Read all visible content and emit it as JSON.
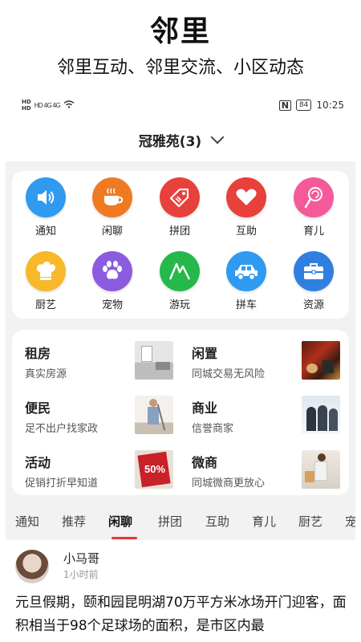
{
  "promo": {
    "title": "邻里",
    "subtitle": "邻里互动、邻里交流、小区动态"
  },
  "status_bar": {
    "left": "HD 4G 4G",
    "battery": "84",
    "time": "10:25"
  },
  "community": {
    "name": "冠雅苑(3)"
  },
  "categories": [
    {
      "label": "通知",
      "icon": "speaker-icon",
      "color": "#2f9af0"
    },
    {
      "label": "闲聊",
      "icon": "coffee-cup-icon",
      "color": "#f07a22"
    },
    {
      "label": "拼团",
      "icon": "tag-icon",
      "color": "#e8403a"
    },
    {
      "label": "互助",
      "icon": "heart-icon",
      "color": "#e8403a"
    },
    {
      "label": "育儿",
      "icon": "lollipop-icon",
      "color": "#f45a9a"
    },
    {
      "label": "厨艺",
      "icon": "chef-hat-icon",
      "color": "#f7b82a"
    },
    {
      "label": "宠物",
      "icon": "paw-icon",
      "color": "#8b5be0"
    },
    {
      "label": "游玩",
      "icon": "mountain-icon",
      "color": "#25b84a"
    },
    {
      "label": "拼车",
      "icon": "car-icon",
      "color": "#2f9af0"
    },
    {
      "label": "资源",
      "icon": "briefcase-icon",
      "color": "#2f7fe0"
    }
  ],
  "services": [
    {
      "title": "租房",
      "desc": "真实房源",
      "image": "room-photo"
    },
    {
      "title": "闲置",
      "desc": "同城交易无风险",
      "image": "vintage-items-photo"
    },
    {
      "title": "便民",
      "desc": "足不出户找家政",
      "image": "cleaning-photo"
    },
    {
      "title": "商业",
      "desc": "信誉商家",
      "image": "business-people-photo"
    },
    {
      "title": "活动",
      "desc": "促销打折早知道",
      "image": "sale-50-photo"
    },
    {
      "title": "微商",
      "desc": "同城微商更放心",
      "image": "shopping-woman-photo"
    }
  ],
  "sale_badge": "50%",
  "tabs": [
    "通知",
    "推荐",
    "闲聊",
    "拼团",
    "互助",
    "育儿",
    "厨艺",
    "宠"
  ],
  "active_tab": "闲聊",
  "accent_color": "#e53935",
  "post": {
    "author": "小马哥",
    "time": "1小时前",
    "body": "元旦假期，颐和园昆明湖70万平方米冰场开门迎客，面积相当于98个足球场的面积，是市区内最"
  }
}
